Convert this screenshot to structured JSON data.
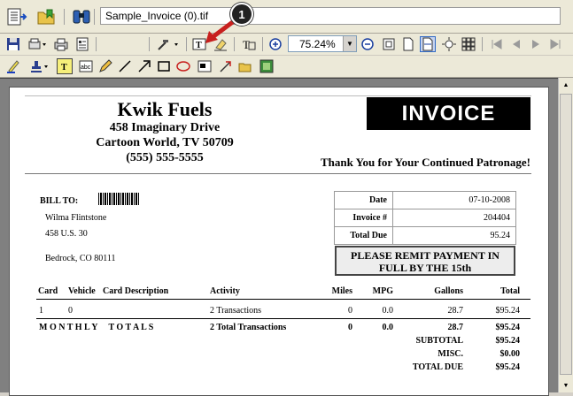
{
  "titlebar": {
    "filename": "Sample_Invoice (0).tif",
    "icons": [
      "properties-icon",
      "open-folder-icon",
      "binoculars-icon"
    ]
  },
  "toolbar": {
    "zoom_value": "75.24%",
    "callout_number": "1"
  },
  "invoice": {
    "company_name": "Kwik Fuels",
    "address_line1": "458 Imaginary Drive",
    "address_line2": "Cartoon World, TV 50709",
    "phone": "(555) 555-5555",
    "title": "INVOICE",
    "thanks": "Thank You for Your Continued Patronage!",
    "bill_to_label": "BILL TO:",
    "bill_to": {
      "name": "Wilma Flintstone",
      "street": "458 U.S. 30",
      "city": "Bedrock, CO 80111"
    },
    "info": [
      {
        "label": "Date",
        "value": "07-10-2008"
      },
      {
        "label": "Invoice #",
        "value": "204404"
      },
      {
        "label": "Total Due",
        "value": "95.24"
      }
    ],
    "remit_line1": "PLEASE REMIT PAYMENT IN",
    "remit_line2": "FULL BY THE 15th",
    "columns": {
      "card": "Card",
      "vehicle": "Vehicle",
      "card_description": "Card Description",
      "activity": "Activity",
      "miles": "Miles",
      "mpg": "MPG",
      "gallons": "Gallons",
      "total": "Total"
    },
    "row": {
      "card": "1",
      "vehicle": "0",
      "activity": "2 Transactions",
      "miles": "0",
      "mpg": "0.0",
      "gallons": "28.7",
      "total": "$95.24"
    },
    "monthly": {
      "label": "M O N T H L Y     T O T A L S",
      "activity": "2 Total Transactions",
      "miles": "0",
      "mpg": "0.0",
      "gallons": "28.7",
      "total": "$95.24"
    },
    "summary": [
      {
        "label": "SUBTOTAL",
        "value": "$95.24"
      },
      {
        "label": "MISC.",
        "value": "$0.00"
      },
      {
        "label": "TOTAL DUE",
        "value": "$95.24"
      }
    ]
  }
}
